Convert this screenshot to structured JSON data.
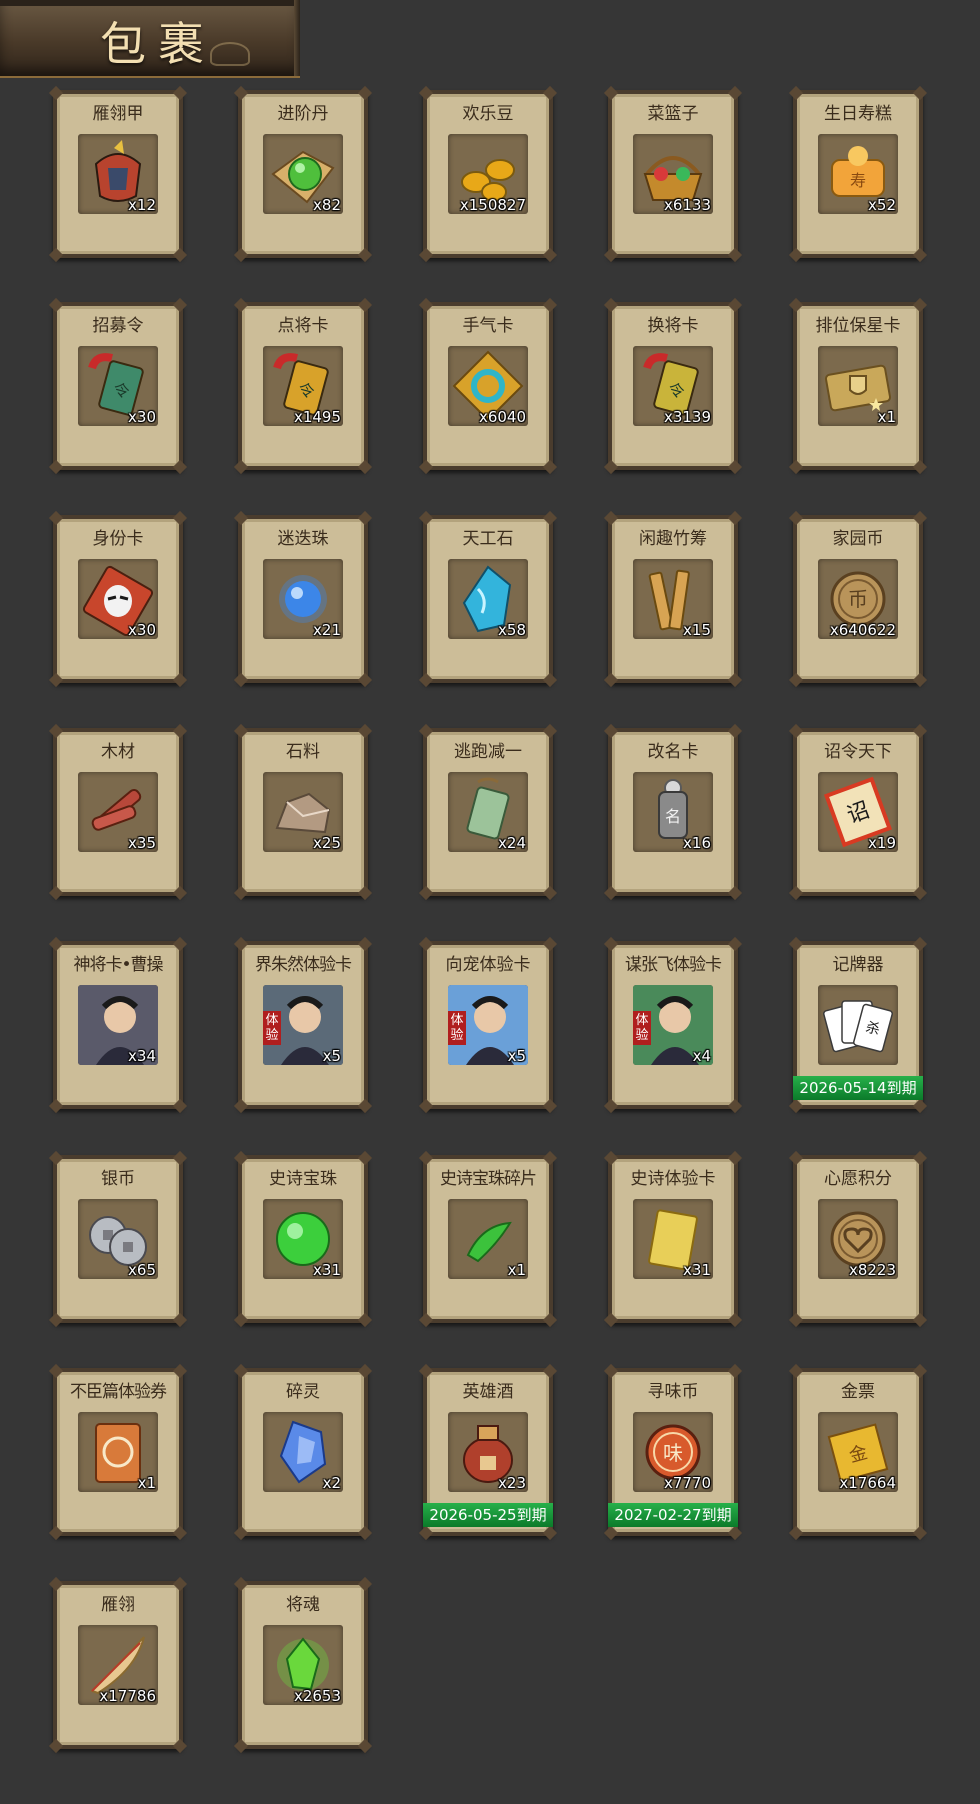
{
  "header": {
    "title": "包裹"
  },
  "items": [
    {
      "name": "雁翎甲",
      "count": "x12",
      "icon": "armor-icon",
      "color": "#b8432e"
    },
    {
      "name": "进阶丹",
      "count": "x82",
      "icon": "green-pill-icon",
      "color": "#4fbf3c"
    },
    {
      "name": "欢乐豆",
      "count": "x150827",
      "icon": "gold-beans-icon",
      "color": "#e8a818"
    },
    {
      "name": "菜篮子",
      "count": "x6133",
      "icon": "basket-icon",
      "color": "#c48a2c"
    },
    {
      "name": "生日寿糕",
      "count": "x52",
      "icon": "birthday-cake-icon",
      "color": "#f2a43a"
    },
    {
      "name": "招募令",
      "count": "x30",
      "icon": "recruit-token-icon",
      "color": "#3f8a6a"
    },
    {
      "name": "点将卡",
      "count": "x1495",
      "icon": "general-card-icon",
      "color": "#d8a22a"
    },
    {
      "name": "手气卡",
      "count": "x6040",
      "icon": "luck-card-icon",
      "color": "#2fb5c8"
    },
    {
      "name": "换将卡",
      "count": "x3139",
      "icon": "swap-general-card-icon",
      "color": "#c9b43a"
    },
    {
      "name": "排位保星卡",
      "count": "x1",
      "icon": "rank-star-card-icon",
      "color": "#c9a85a"
    },
    {
      "name": "身份卡",
      "count": "x30",
      "icon": "identity-card-icon",
      "color": "#c8462c"
    },
    {
      "name": "迷迭珠",
      "count": "x21",
      "icon": "blue-orb-icon",
      "color": "#3c86e8"
    },
    {
      "name": "天工石",
      "count": "x58",
      "icon": "blue-crystal-icon",
      "color": "#33b4dc"
    },
    {
      "name": "闲趣竹筹",
      "count": "x15",
      "icon": "bamboo-tally-icon",
      "color": "#d8a453"
    },
    {
      "name": "家园币",
      "count": "x640622",
      "icon": "home-coin-icon",
      "color": "#b9945a"
    },
    {
      "name": "木材",
      "count": "x35",
      "icon": "wood-icon",
      "color": "#b8483a"
    },
    {
      "name": "石料",
      "count": "x25",
      "icon": "stone-icon",
      "color": "#b39a82"
    },
    {
      "name": "逃跑减一",
      "count": "x24",
      "icon": "jade-tag-icon",
      "color": "#9cc39a"
    },
    {
      "name": "改名卡",
      "count": "x16",
      "icon": "rename-tag-icon",
      "color": "#8a8a8a"
    },
    {
      "name": "诏令天下",
      "count": "x19",
      "icon": "scroll-icon",
      "color": "#d83a22"
    },
    {
      "name": "神将卡•曹操",
      "count": "x34",
      "icon": "cao-cao-portrait-icon",
      "color": "#5a5a6a"
    },
    {
      "name": "界朱然体验卡",
      "count": "x5",
      "icon": "zhu-ran-portrait-icon",
      "color": "#5b6a78",
      "tag": "体验"
    },
    {
      "name": "向宠体验卡",
      "count": "x5",
      "icon": "xiang-chong-portrait-icon",
      "color": "#6aa0d8",
      "tag": "体验"
    },
    {
      "name": "谋张飞体验卡",
      "count": "x4",
      "icon": "zhang-fei-portrait-icon",
      "color": "#4a8a5a",
      "tag": "体验"
    },
    {
      "name": "记牌器",
      "count": "",
      "icon": "playing-cards-icon",
      "color": "#ffffff",
      "expiry": "2026-05-14到期"
    },
    {
      "name": "银币",
      "count": "x65",
      "icon": "silver-coins-icon",
      "color": "#b8bcc2"
    },
    {
      "name": "史诗宝珠",
      "count": "x31",
      "icon": "green-orb-icon",
      "color": "#3ccf3c"
    },
    {
      "name": "史诗宝珠碎片",
      "count": "x1",
      "icon": "green-shard-icon",
      "color": "#3cc23c"
    },
    {
      "name": "史诗体验卡",
      "count": "x31",
      "icon": "gold-card-icon",
      "color": "#e8cf58"
    },
    {
      "name": "心愿积分",
      "count": "x8223",
      "icon": "heart-coin-icon",
      "color": "#b9945a"
    },
    {
      "name": "不臣篇体验券",
      "count": "x1",
      "icon": "ticket-icon",
      "color": "#d87a3a"
    },
    {
      "name": "碎灵",
      "count": "x2",
      "icon": "spirit-shard-icon",
      "color": "#5a8ae8"
    },
    {
      "name": "英雄酒",
      "count": "x23",
      "icon": "wine-jar-icon",
      "color": "#b0402c",
      "expiry": "2026-05-25到期"
    },
    {
      "name": "寻味币",
      "count": "x7770",
      "icon": "flavor-coin-icon",
      "color": "#d85a2c",
      "expiry": "2027-02-27到期"
    },
    {
      "name": "金票",
      "count": "x17664",
      "icon": "gold-ticket-icon",
      "color": "#e8b830"
    },
    {
      "name": "雁翎",
      "count": "x17786",
      "icon": "feather-icon",
      "color": "#e8c890"
    },
    {
      "name": "将魂",
      "count": "x2653",
      "icon": "general-soul-icon",
      "color": "#6ad83c"
    }
  ]
}
